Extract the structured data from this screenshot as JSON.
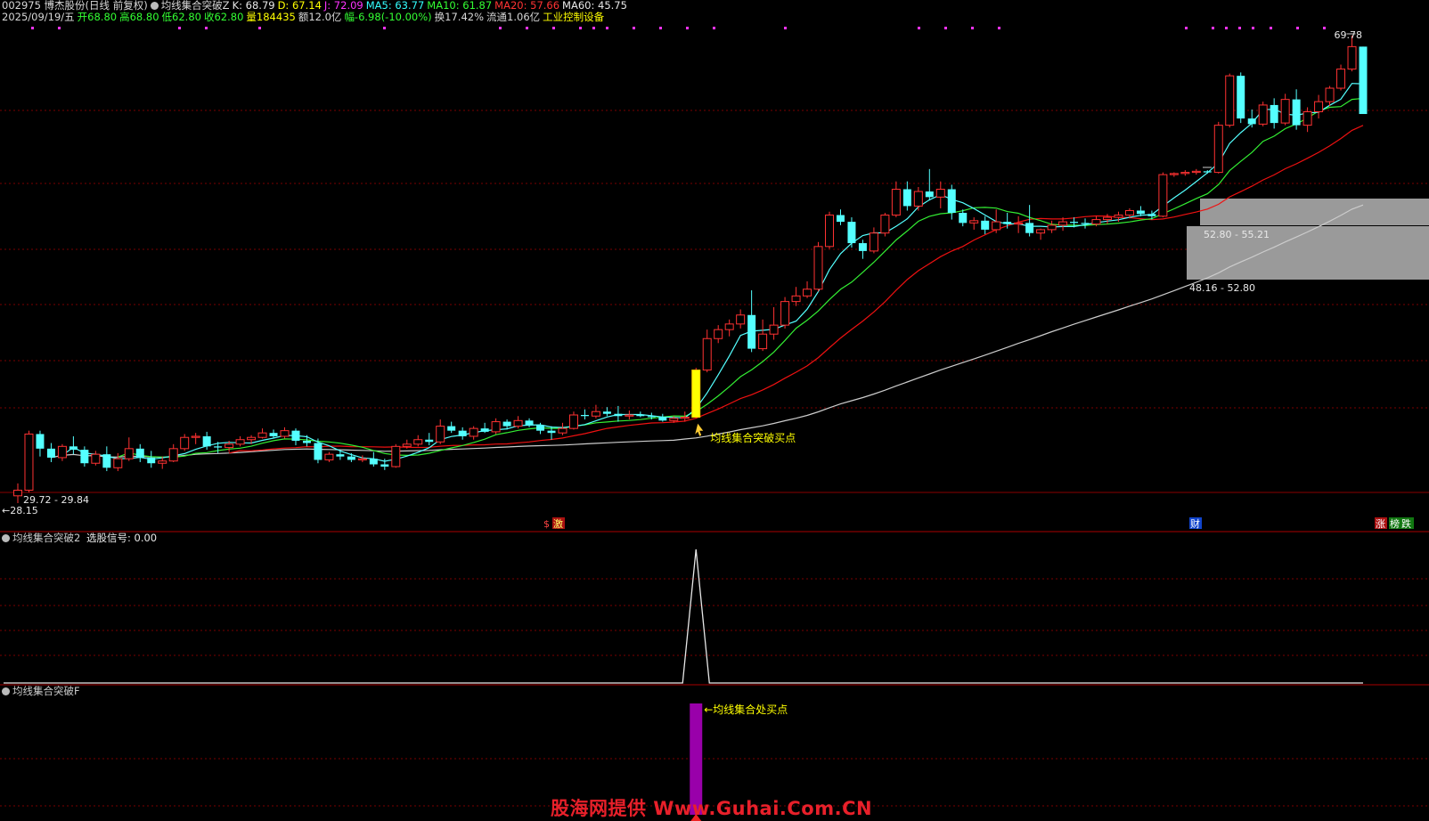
{
  "header": {
    "line1": [
      {
        "text": "002975 博杰股份(日线 前复权)",
        "color": "#d8d8d8"
      },
      {
        "text": "均线集合突破Z",
        "color": "#d8d8d8",
        "icon": true
      },
      {
        "text": "K: 68.79",
        "color": "#e8e8e8"
      },
      {
        "text": "D: 67.14",
        "color": "#ffff00"
      },
      {
        "text": "J: 72.09",
        "color": "#ff33ff"
      },
      {
        "text": "MA5: 63.77",
        "color": "#33ffff"
      },
      {
        "text": "MA10: 61.87",
        "color": "#33ff33"
      },
      {
        "text": "MA20: 57.66",
        "color": "#ff3333"
      },
      {
        "text": "MA60: 45.75",
        "color": "#e8e8e8"
      }
    ],
    "line2": [
      {
        "text": "2025/09/19/五",
        "color": "#d8d8d8"
      },
      {
        "text": "开68.80",
        "color": "#33ff33"
      },
      {
        "text": "高68.80",
        "color": "#33ff33"
      },
      {
        "text": "低62.80",
        "color": "#33ff33"
      },
      {
        "text": "收62.80",
        "color": "#33ff33"
      },
      {
        "text": "量184435",
        "color": "#ffff00"
      },
      {
        "text": "额12.0亿",
        "color": "#d8d8d8"
      },
      {
        "text": "幅-6.98(-10.00%)",
        "color": "#33ff33"
      },
      {
        "text": "换17.42%",
        "color": "#d8d8d8"
      },
      {
        "text": "流通1.06亿",
        "color": "#d8d8d8"
      },
      {
        "text": "工业控制设备",
        "color": "#ffff00"
      }
    ]
  },
  "panels": {
    "p2_title": "均线集合突破2",
    "p2_value": "选股信号: 0.00",
    "p3_title": "均线集合突破F"
  },
  "annotations": {
    "buy_point": "均线集合突破买点",
    "buy_point2": "←均线集合处买点",
    "max_price": "69.78",
    "min_price": "←28.15",
    "gap_low": "29.72 - 29.84",
    "gap1": "48.16 - 52.80",
    "gap2": "52.80 - 55.21",
    "tag_s": "$",
    "tag_ji": "激",
    "tag_cai": "财",
    "tag_zhang": "涨",
    "tag_bang": "榜",
    "tag_die": "跌"
  },
  "watermark": "股海网提供 Www.Guhai.Com.CN",
  "colors": {
    "up": "#ff3232",
    "down": "#54ffff",
    "ma5": "#54ffff",
    "ma10": "#33ee33",
    "ma20": "#ee1111",
    "ma60": "#cccccc",
    "grid": "#7a0000",
    "signal": "#ffff00",
    "bar": "#9900aa"
  },
  "chart_data": [
    {
      "type": "candlestick",
      "price_range": [
        28.15,
        69.78
      ],
      "signal_index": 61,
      "candles": [
        [
          28.8,
          29.9,
          28.15,
          29.3
        ],
        [
          29.3,
          34.6,
          29.1,
          34.3
        ],
        [
          34.3,
          34.6,
          32.3,
          33.0
        ],
        [
          33.0,
          33.5,
          31.8,
          32.2
        ],
        [
          32.2,
          33.4,
          31.9,
          33.2
        ],
        [
          33.2,
          34.1,
          32.5,
          32.9
        ],
        [
          32.9,
          33.2,
          31.4,
          31.7
        ],
        [
          31.7,
          32.8,
          31.5,
          32.5
        ],
        [
          32.5,
          33.2,
          31.0,
          31.3
        ],
        [
          31.3,
          32.6,
          31.0,
          32.1
        ],
        [
          32.1,
          34.0,
          31.9,
          33.0
        ],
        [
          33.0,
          33.4,
          31.8,
          32.2
        ],
        [
          32.2,
          32.8,
          31.3,
          31.7
        ],
        [
          31.7,
          32.3,
          31.2,
          31.9
        ],
        [
          31.9,
          33.4,
          31.8,
          33.0
        ],
        [
          33.0,
          34.3,
          32.8,
          34.0
        ],
        [
          34.0,
          34.4,
          33.4,
          34.1
        ],
        [
          34.1,
          34.5,
          32.9,
          33.2
        ],
        [
          33.2,
          33.6,
          32.6,
          33.1
        ],
        [
          33.1,
          33.7,
          32.7,
          33.4
        ],
        [
          33.4,
          34.1,
          33.2,
          33.8
        ],
        [
          33.8,
          34.2,
          33.4,
          34.0
        ],
        [
          34.0,
          34.8,
          33.9,
          34.4
        ],
        [
          34.4,
          34.7,
          33.9,
          34.1
        ],
        [
          34.1,
          34.9,
          33.9,
          34.6
        ],
        [
          34.6,
          34.8,
          33.3,
          33.7
        ],
        [
          33.7,
          34.2,
          33.2,
          33.5
        ],
        [
          33.5,
          33.9,
          31.7,
          32.0
        ],
        [
          32.0,
          32.7,
          31.8,
          32.5
        ],
        [
          32.5,
          32.9,
          32.0,
          32.3
        ],
        [
          32.3,
          32.6,
          31.8,
          32.0
        ],
        [
          32.0,
          32.4,
          31.8,
          32.1
        ],
        [
          32.1,
          32.7,
          31.4,
          31.6
        ],
        [
          31.6,
          32.1,
          31.1,
          31.4
        ],
        [
          31.4,
          33.4,
          31.3,
          33.2
        ],
        [
          33.2,
          33.8,
          33.0,
          33.4
        ],
        [
          33.4,
          34.2,
          33.2,
          33.8
        ],
        [
          33.8,
          34.4,
          33.3,
          33.6
        ],
        [
          33.6,
          35.6,
          33.4,
          35.0
        ],
        [
          35.0,
          35.4,
          34.4,
          34.6
        ],
        [
          34.6,
          34.9,
          33.8,
          34.1
        ],
        [
          34.1,
          35.0,
          33.8,
          34.8
        ],
        [
          34.8,
          35.3,
          34.4,
          34.5
        ],
        [
          34.5,
          35.7,
          34.3,
          35.4
        ],
        [
          35.4,
          35.6,
          34.7,
          35.0
        ],
        [
          35.0,
          35.9,
          34.8,
          35.5
        ],
        [
          35.5,
          35.7,
          34.9,
          35.1
        ],
        [
          35.1,
          35.3,
          34.3,
          34.6
        ],
        [
          34.6,
          35.0,
          33.8,
          34.4
        ],
        [
          34.4,
          35.3,
          34.2,
          34.8
        ],
        [
          34.8,
          36.3,
          34.7,
          36.0
        ],
        [
          36.0,
          36.5,
          35.6,
          35.9
        ],
        [
          35.9,
          36.9,
          35.7,
          36.3
        ],
        [
          36.3,
          36.7,
          35.9,
          36.1
        ],
        [
          36.1,
          36.8,
          35.4,
          35.9
        ],
        [
          35.9,
          36.4,
          35.6,
          36.0
        ],
        [
          36.0,
          36.3,
          35.8,
          35.9
        ],
        [
          35.9,
          36.2,
          35.6,
          35.8
        ],
        [
          35.8,
          36.1,
          35.4,
          35.5
        ],
        [
          35.5,
          35.9,
          35.3,
          35.7
        ],
        [
          35.7,
          36.3,
          35.4,
          35.8
        ],
        [
          35.8,
          40.2,
          35.7,
          40.0
        ],
        [
          40.0,
          43.6,
          39.8,
          42.8
        ],
        [
          42.8,
          44.0,
          42.4,
          43.6
        ],
        [
          43.6,
          44.5,
          43.0,
          44.1
        ],
        [
          44.1,
          45.4,
          43.7,
          44.9
        ],
        [
          44.9,
          47.1,
          41.6,
          41.9
        ],
        [
          41.9,
          44.5,
          41.7,
          43.2
        ],
        [
          43.2,
          45.6,
          42.7,
          44.0
        ],
        [
          44.0,
          46.5,
          43.7,
          46.1
        ],
        [
          46.1,
          47.4,
          45.7,
          46.6
        ],
        [
          46.6,
          47.9,
          46.4,
          47.2
        ],
        [
          47.2,
          51.4,
          47.0,
          51.0
        ],
        [
          51.0,
          54.1,
          50.8,
          53.8
        ],
        [
          53.8,
          54.3,
          52.9,
          53.2
        ],
        [
          53.2,
          53.6,
          50.9,
          51.3
        ],
        [
          51.3,
          51.6,
          49.9,
          50.6
        ],
        [
          50.6,
          52.7,
          50.4,
          52.2
        ],
        [
          52.2,
          54.0,
          51.9,
          53.8
        ],
        [
          53.8,
          56.8,
          53.6,
          56.1
        ],
        [
          56.1,
          56.8,
          54.2,
          54.6
        ],
        [
          54.6,
          56.3,
          54.2,
          55.9
        ],
        [
          55.9,
          57.9,
          55.1,
          55.4
        ],
        [
          55.4,
          56.8,
          54.4,
          56.1
        ],
        [
          56.1,
          56.5,
          53.4,
          54.0
        ],
        [
          54.0,
          54.3,
          52.8,
          53.1
        ],
        [
          53.1,
          53.6,
          52.5,
          53.3
        ],
        [
          53.3,
          53.7,
          52.1,
          52.5
        ],
        [
          52.5,
          54.3,
          52.2,
          53.2
        ],
        [
          53.2,
          54.0,
          52.6,
          53.0
        ],
        [
          53.0,
          53.7,
          52.2,
          53.1
        ],
        [
          53.1,
          54.7,
          51.9,
          52.2
        ],
        [
          52.2,
          52.6,
          51.6,
          52.5
        ],
        [
          52.5,
          53.3,
          52.2,
          52.9
        ],
        [
          52.9,
          53.6,
          52.4,
          53.2
        ],
        [
          53.2,
          53.6,
          52.7,
          53.1
        ],
        [
          53.1,
          53.5,
          52.6,
          53.0
        ],
        [
          53.0,
          53.7,
          52.8,
          53.4
        ],
        [
          53.4,
          53.9,
          53.0,
          53.6
        ],
        [
          53.6,
          54.1,
          53.2,
          53.8
        ],
        [
          53.8,
          54.4,
          53.5,
          54.2
        ],
        [
          54.2,
          54.6,
          53.7,
          53.9
        ],
        [
          53.9,
          54.2,
          53.4,
          53.7
        ],
        [
          53.7,
          57.6,
          53.6,
          57.4
        ],
        [
          57.4,
          57.6,
          57.2,
          57.5
        ],
        [
          57.5,
          57.8,
          57.3,
          57.6
        ],
        [
          57.6,
          57.9,
          57.4,
          57.7
        ],
        [
          57.7,
          57.8,
          57.5,
          57.6
        ],
        [
          57.6,
          62.1,
          57.5,
          61.8
        ],
        [
          61.8,
          66.4,
          61.6,
          66.2
        ],
        [
          66.2,
          66.5,
          62.0,
          62.4
        ],
        [
          62.4,
          63.2,
          61.6,
          61.9
        ],
        [
          61.9,
          63.9,
          61.7,
          63.6
        ],
        [
          63.6,
          64.2,
          61.5,
          62.0
        ],
        [
          62.0,
          64.6,
          61.8,
          64.1
        ],
        [
          64.1,
          65.0,
          61.4,
          61.8
        ],
        [
          61.8,
          63.4,
          61.2,
          63.0
        ],
        [
          63.0,
          64.5,
          62.4,
          63.9
        ],
        [
          63.9,
          65.3,
          63.5,
          65.1
        ],
        [
          65.1,
          67.2,
          64.9,
          66.8
        ],
        [
          66.8,
          69.78,
          66.6,
          68.8
        ],
        [
          68.8,
          68.8,
          62.8,
          62.8
        ]
      ]
    },
    {
      "type": "line",
      "name": "选股信号",
      "spike_index": 61,
      "value": 0.0
    },
    {
      "type": "bar",
      "bar_index": 61
    }
  ]
}
